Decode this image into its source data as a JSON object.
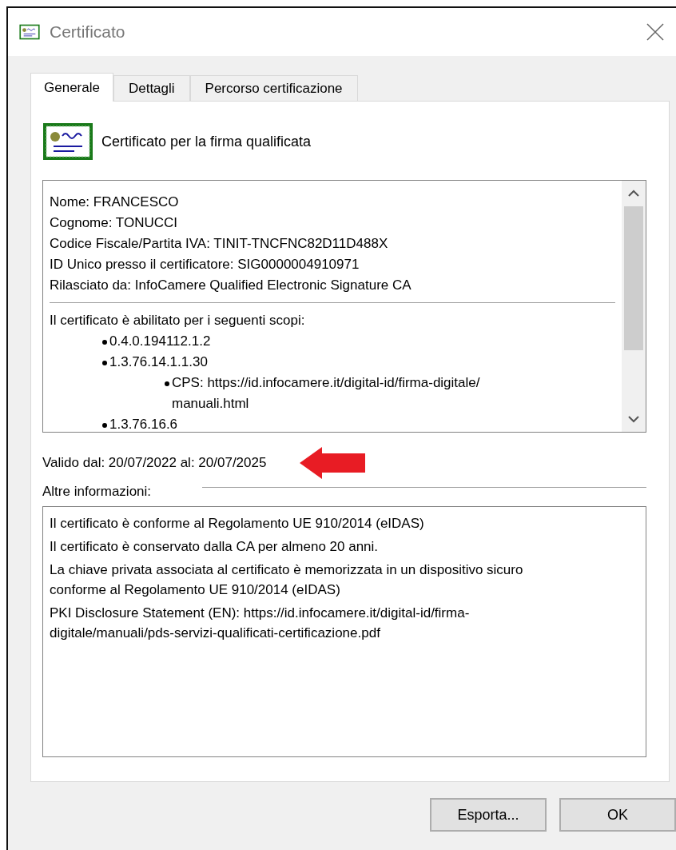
{
  "window": {
    "title": "Certificato"
  },
  "tabs": [
    {
      "label": "Generale",
      "selected": true
    },
    {
      "label": "Dettagli",
      "selected": false
    },
    {
      "label": "Percorso certificazione",
      "selected": false
    }
  ],
  "header": "Certificato per la firma qualificata",
  "subject_fields": [
    "Nome: FRANCESCO",
    "Cognome: TONUCCI",
    "Codice Fiscale/Partita IVA: TINIT-TNCFNC82D11D488X",
    "ID Unico presso il certificatore: SIG0000004910971",
    "Rilasciato da: InfoCamere Qualified Electronic Signature CA"
  ],
  "purposes_heading": "Il certificato è abilitato per i seguenti scopi:",
  "purposes": [
    {
      "text": "0.4.0.194112.1.2"
    },
    {
      "text": "1.3.76.14.1.1.30",
      "children": [
        {
          "text": "CPS: https://id.infocamere.it/digital-id/firma-digitale/ manuali.html"
        }
      ]
    },
    {
      "text": "1.3.76.16.6"
    }
  ],
  "validity": "Valido dal: 20/07/2022 al: 20/07/2025",
  "other_info_label": "Altre informazioni:",
  "other_info": [
    "Il certificato è conforme al Regolamento UE 910/2014 (eIDAS)",
    "Il certificato è conservato dalla CA per almeno 20 anni.",
    "La chiave privata associata al certificato è memorizzata in un dispositivo sicuro conforme al Regolamento UE 910/2014 (eIDAS)",
    "PKI Disclosure Statement (EN): https://id.infocamere.it/digital-id/firma-digitale/manuali/pds-servizi-qualificati-certificazione.pdf"
  ],
  "buttons": [
    "Esporta...",
    "OK"
  ]
}
